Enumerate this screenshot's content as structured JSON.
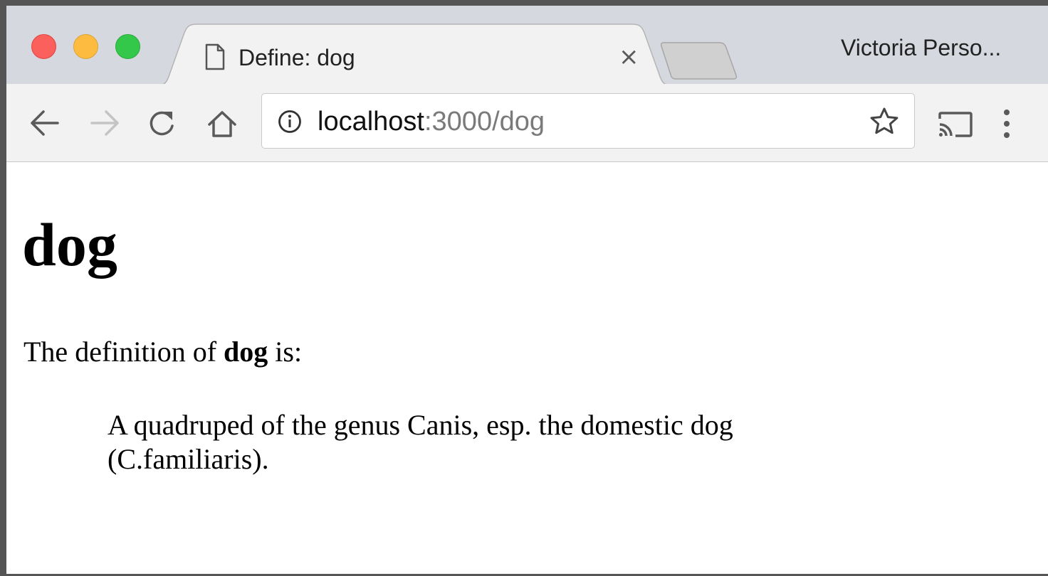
{
  "browser": {
    "tab": {
      "title": "Define: dog",
      "icon": "page-icon",
      "close_glyph": "×"
    },
    "profile_name": "Victoria Perso...",
    "address_bar": {
      "host": "localhost",
      "rest": ":3000/dog"
    },
    "icons": {
      "back": "arrow-left-icon",
      "forward": "arrow-right-icon",
      "reload": "reload-icon",
      "home": "home-icon",
      "info": "info-icon",
      "bookmark": "star-icon",
      "cast": "cast-icon",
      "menu": "kebab-menu-icon"
    },
    "colors": {
      "close": "#fc605c",
      "minimize": "#fdbc40",
      "maximize": "#34c84a"
    }
  },
  "page": {
    "heading": "dog",
    "intro_prefix": "The definition of ",
    "intro_word": "dog",
    "intro_suffix": " is:",
    "definition": "A quadruped of the genus Canis, esp. the domestic dog (C.familiaris)."
  }
}
